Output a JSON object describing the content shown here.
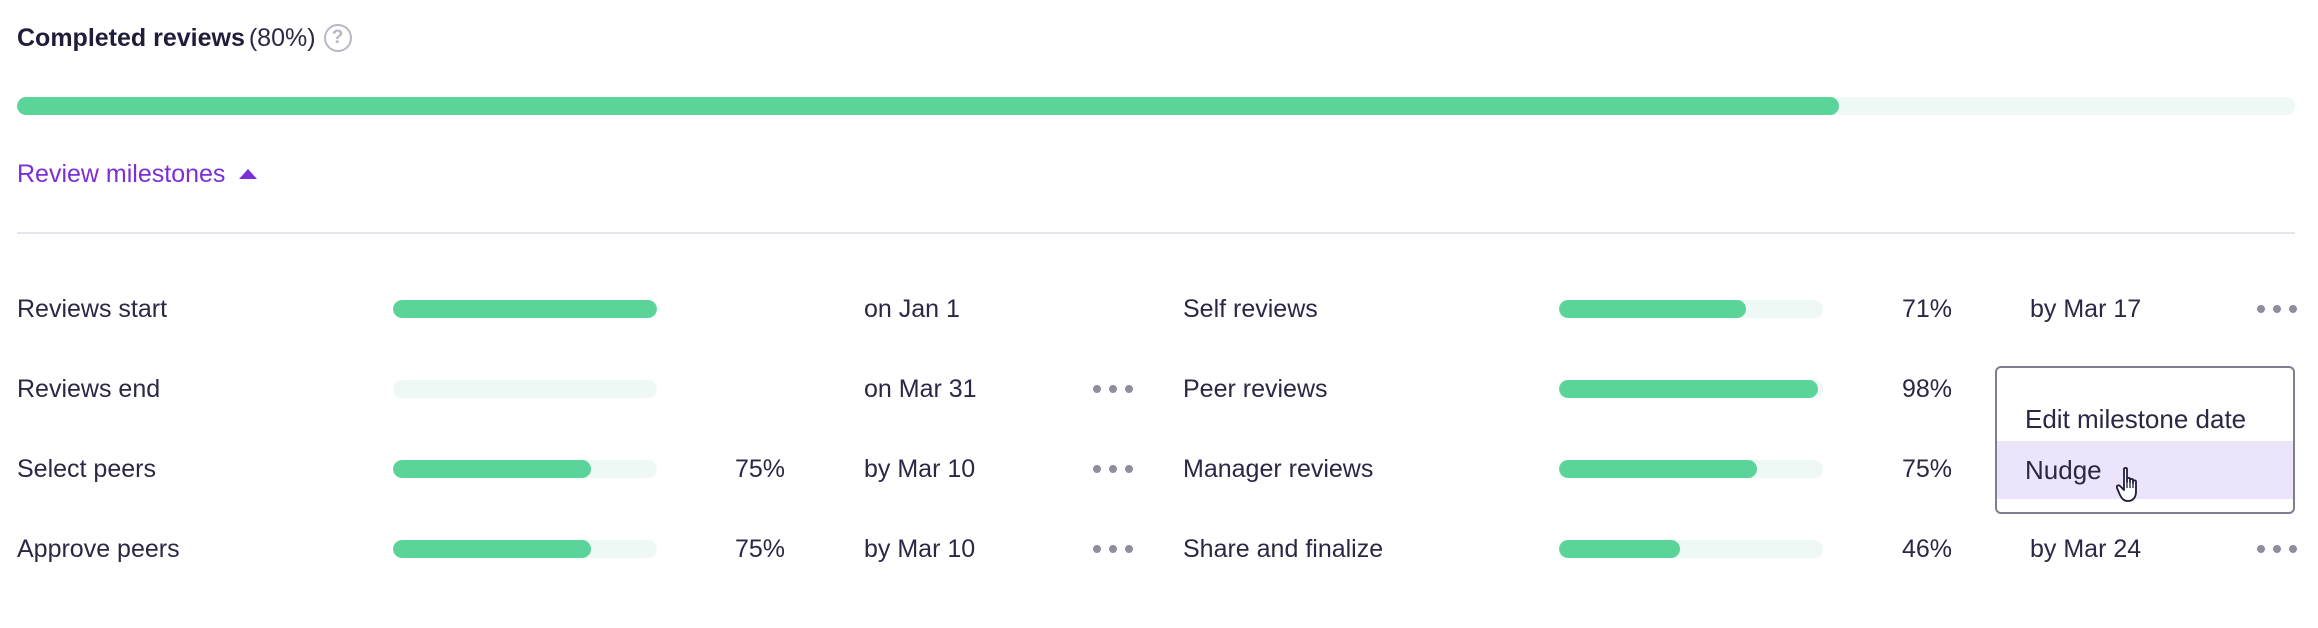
{
  "header": {
    "title": "Completed reviews",
    "percent_text": "(80%)",
    "help_icon": "?",
    "progress": 0.8
  },
  "toggle": {
    "label": "Review milestones",
    "icon": "caret-up-icon"
  },
  "colors": {
    "accent": "#7b2fd6",
    "progress": "#5bd49a",
    "track": "#eef8f4"
  },
  "milestones_left": [
    {
      "label": "Reviews start",
      "progress": 1.0,
      "percent": "",
      "date": "on Jan 1",
      "has_menu": false
    },
    {
      "label": "Reviews end",
      "progress": 0.0,
      "percent": "",
      "date": "on Mar 31",
      "has_menu": true
    },
    {
      "label": "Select peers",
      "progress": 0.75,
      "percent": "75%",
      "date": "by Mar 10",
      "has_menu": true
    },
    {
      "label": "Approve peers",
      "progress": 0.75,
      "percent": "75%",
      "date": "by Mar 10",
      "has_menu": true
    }
  ],
  "milestones_right": [
    {
      "label": "Self reviews",
      "progress": 0.71,
      "percent": "71%",
      "date": "by Mar 17",
      "has_menu": true
    },
    {
      "label": "Peer reviews",
      "progress": 0.98,
      "percent": "98%",
      "date": "",
      "has_menu": false
    },
    {
      "label": "Manager reviews",
      "progress": 0.75,
      "percent": "75%",
      "date": "",
      "has_menu": false
    },
    {
      "label": "Share and finalize",
      "progress": 0.46,
      "percent": "46%",
      "date": "by Mar 24",
      "has_menu": true
    }
  ],
  "context_menu": {
    "items": [
      {
        "label": "Edit milestone date",
        "hover": false
      },
      {
        "label": "Nudge",
        "hover": true
      }
    ]
  }
}
